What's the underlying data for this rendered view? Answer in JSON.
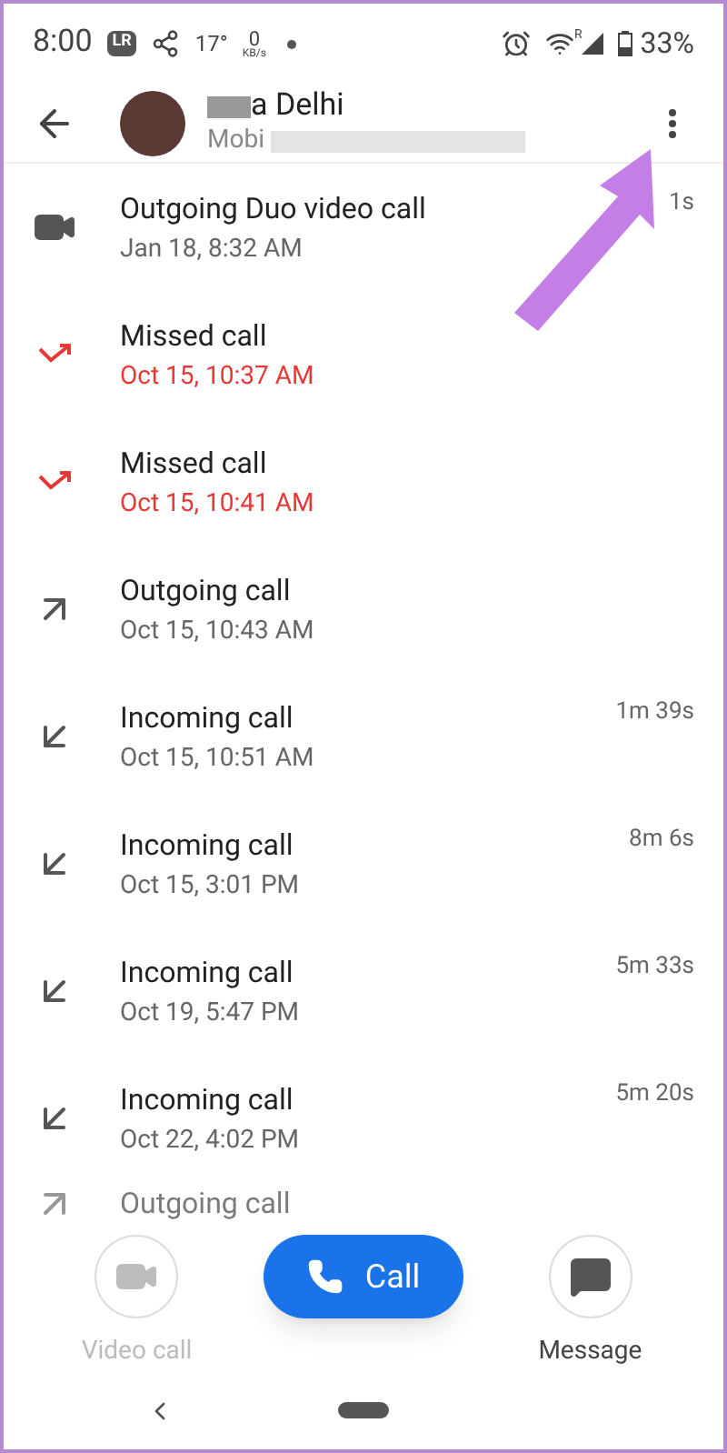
{
  "status_bar": {
    "time": "8:00",
    "app_badge": "LR",
    "temperature": "17°",
    "speed_value": "0",
    "speed_unit": "KB/s",
    "battery": "33%",
    "roaming": "R"
  },
  "header": {
    "name": "a Delhi",
    "subtitle": "Mobi"
  },
  "calls": [
    {
      "kind": "video",
      "title": "Outgoing Duo video call",
      "date": "Jan 18, 8:32 AM",
      "duration": "1s"
    },
    {
      "kind": "missed",
      "title": "Missed call",
      "date": "Oct 15, 10:37 AM"
    },
    {
      "kind": "missed",
      "title": "Missed call",
      "date": "Oct 15, 10:41 AM"
    },
    {
      "kind": "outgoing",
      "title": "Outgoing call",
      "date": "Oct 15, 10:43 AM"
    },
    {
      "kind": "incoming",
      "title": "Incoming call",
      "date": "Oct 15, 10:51 AM",
      "duration": "1m 39s"
    },
    {
      "kind": "incoming",
      "title": "Incoming call",
      "date": "Oct 15, 3:01 PM",
      "duration": "8m 6s"
    },
    {
      "kind": "incoming",
      "title": "Incoming call",
      "date": "Oct 19, 5:47 PM",
      "duration": "5m 33s"
    },
    {
      "kind": "incoming",
      "title": "Incoming call",
      "date": "Oct 22, 4:02 PM",
      "duration": "5m 20s"
    },
    {
      "kind": "outgoing",
      "title": "Outgoing call"
    }
  ],
  "actions": [
    {
      "kind": "video",
      "label": "Video call",
      "disabled": true
    },
    {
      "kind": "call",
      "label": "Call"
    },
    {
      "kind": "message",
      "label": "Message",
      "disabled": false
    }
  ]
}
